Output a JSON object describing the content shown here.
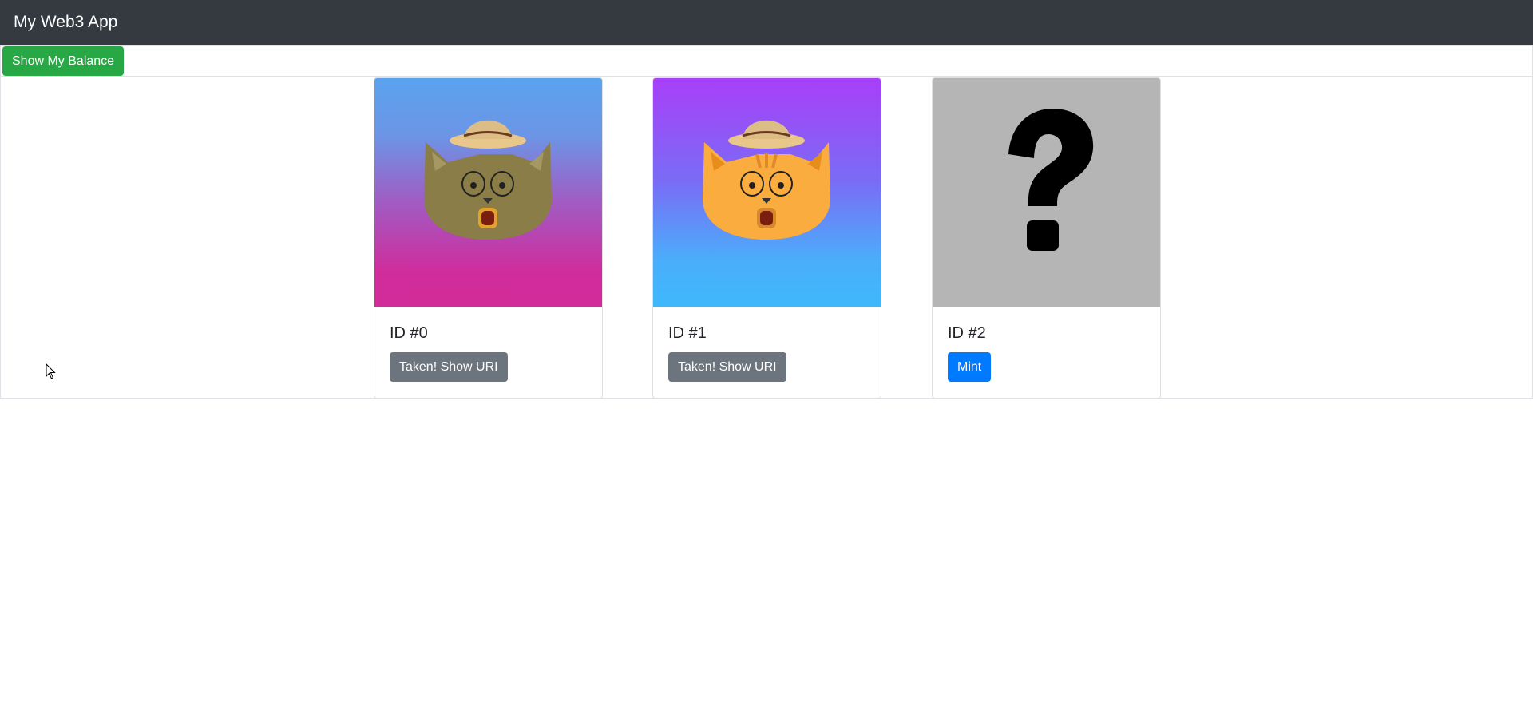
{
  "navbar": {
    "brand": "My Web3 App"
  },
  "toolbar": {
    "balance_button": "Show My Balance"
  },
  "cards": [
    {
      "title": "ID #0",
      "button": "Taken! Show URI",
      "status": "taken",
      "image": "cowboy-cat-brown-icon"
    },
    {
      "title": "ID #1",
      "button": "Taken! Show URI",
      "status": "taken",
      "image": "cowboy-cat-orange-icon"
    },
    {
      "title": "ID #2",
      "button": "Mint",
      "status": "available",
      "image": "question-mark-icon"
    }
  ],
  "colors": {
    "navbar": "#343a40",
    "success": "#28a745",
    "secondary": "#6c757d",
    "primary": "#007bff",
    "placeholder_bg": "#b5b5b5"
  }
}
